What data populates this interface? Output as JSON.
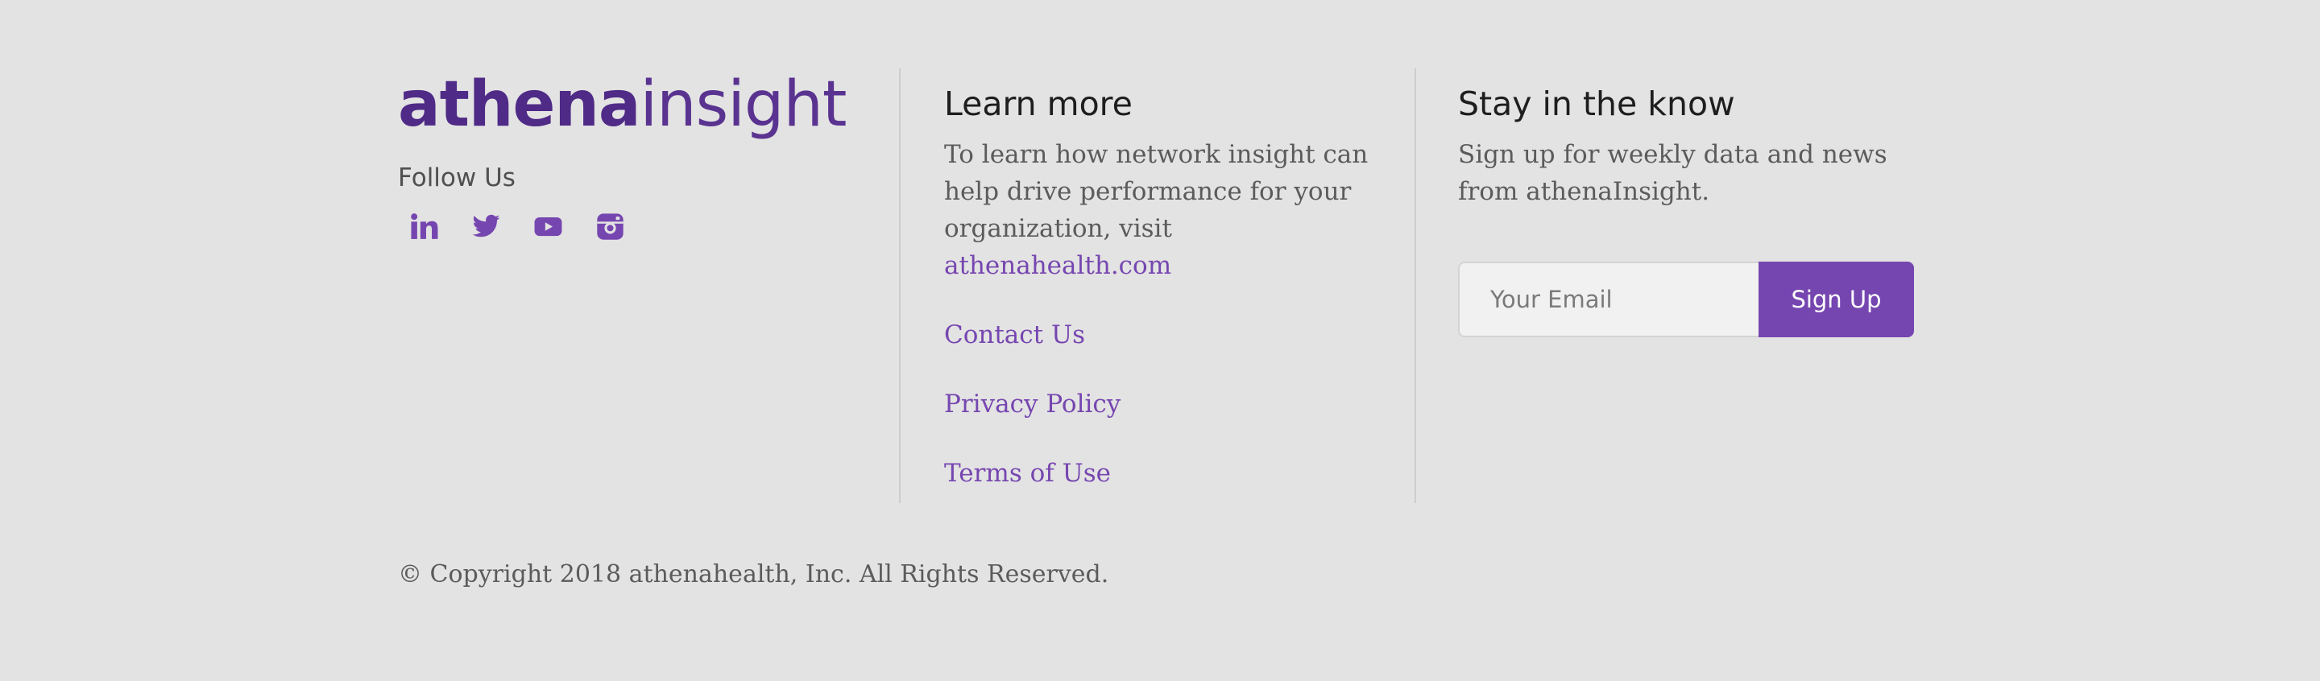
{
  "brand": {
    "logo_bold": "athena",
    "logo_light": "insight",
    "follow_label": "Follow Us",
    "social_icons": [
      "linkedin-icon",
      "twitter-icon",
      "youtube-icon",
      "instagram-icon"
    ]
  },
  "learn_more": {
    "title": "Learn more",
    "body": "To learn how network insight can help drive performance for your organization, visit",
    "site_link": "athenahealth.com",
    "links": [
      "Contact Us",
      "Privacy Policy",
      "Terms of Use"
    ]
  },
  "stay": {
    "title": "Stay in the know",
    "body": "Sign up for weekly data and news from athenaInsight.",
    "email_placeholder": "Your Email",
    "email_value": "",
    "signup_label": "Sign Up"
  },
  "copyright": "© Copyright 2018 athenahealth, Inc. All Rights Reserved.",
  "colors": {
    "background": "#e3e3e3",
    "brand_purple": "#7646b0",
    "logo_purple": "#4f2a86",
    "heading": "#1e1e1e",
    "body_text": "#5b5b5b"
  }
}
